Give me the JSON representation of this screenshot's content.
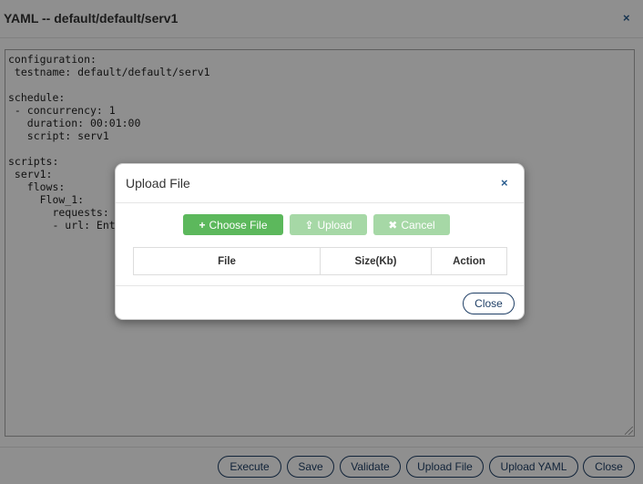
{
  "yaml_modal": {
    "title": "YAML -- default/default/serv1",
    "close_glyph": "×",
    "content": "configuration:\n testname: default/default/serv1\n\nschedule:\n - concurrency: 1\n   duration: 00:01:00\n   script: serv1\n\nscripts:\n serv1:\n   flows:\n     Flow_1:\n       requests:\n       - url: Ente",
    "buttons": {
      "execute": "Execute",
      "save": "Save",
      "validate": "Validate",
      "upload_file": "Upload File",
      "upload_yaml": "Upload YAML",
      "close": "Close"
    }
  },
  "upload_dialog": {
    "title": "Upload File",
    "close_glyph": "×",
    "buttons": {
      "choose_file": {
        "icon": "plus-icon",
        "glyph": "+",
        "label": "Choose File"
      },
      "upload": {
        "icon": "upload-icon",
        "glyph": "⇪",
        "label": "Upload"
      },
      "cancel": {
        "icon": "cancel-icon",
        "glyph": "✖",
        "label": "Cancel"
      }
    },
    "table": {
      "headers": [
        "File",
        "Size(Kb)",
        "Action"
      ]
    },
    "close_label": "Close"
  },
  "colors": {
    "primary_green": "#5cb85c",
    "disabled_green": "#a6d8a6",
    "outline_blue": "#1f3f66"
  }
}
